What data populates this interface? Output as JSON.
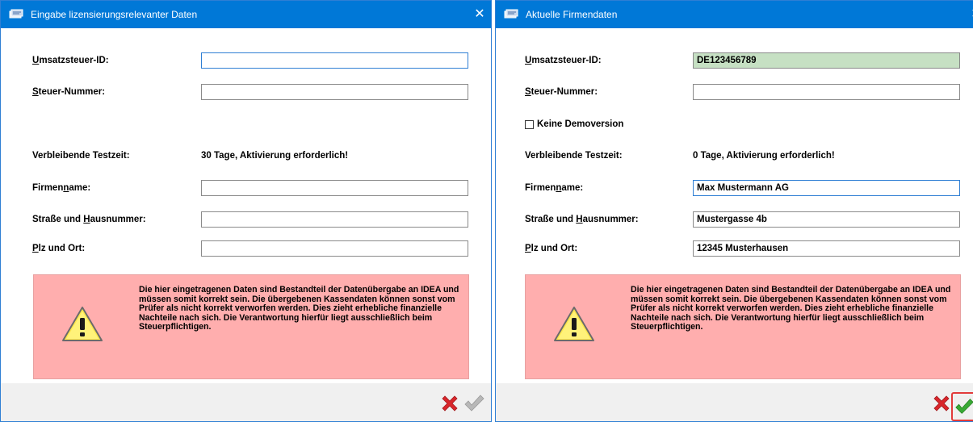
{
  "left_window": {
    "title": "Eingabe lizensierungsrelevanter Daten",
    "close_glyph": "✕",
    "fields": {
      "ust_label_u": "U",
      "ust_label_rest": "msatzsteuer-ID:",
      "ust_value": "",
      "steuer_label_u": "S",
      "steuer_label_rest": "teuer-Nummer:",
      "steuer_value": "",
      "testzeit_label": "Verbleibende Testzeit:",
      "testzeit_value": "30 Tage, Aktivierung erforderlich!",
      "firma_label_pre": "Firmen",
      "firma_label_u": "n",
      "firma_label_post": "ame:",
      "firma_value": "",
      "strasse_label_pre": "Straße und ",
      "strasse_label_u": "H",
      "strasse_label_post": "ausnummer:",
      "strasse_value": "",
      "plz_label_u": "P",
      "plz_label_rest": "lz und Ort:",
      "plz_value": ""
    },
    "warning_text": "Die hier eingetragenen Daten sind Bestandteil der Datenübergabe an IDEA und müssen somit korrekt sein. Die übergebenen Kassendaten können sonst vom Prüfer als nicht korrekt verworfen werden. Dies zieht erhebliche finanzielle Nachteile nach sich. Die Verantwortung hierfür liegt ausschließlich beim Steuerpflichtigen."
  },
  "right_window": {
    "title": "Aktuelle Firmendaten",
    "close_glyph": "✕",
    "fields": {
      "ust_label_u": "U",
      "ust_label_rest": "msatzsteuer-ID:",
      "ust_value": "DE123456789",
      "steuer_label_u": "S",
      "steuer_label_rest": "teuer-Nummer:",
      "steuer_value": "",
      "demo_label": "Keine Demoversion",
      "testzeit_label": "Verbleibende Testzeit:",
      "testzeit_value": "0 Tage, Aktivierung erforderlich!",
      "firma_label_pre": "Firmen",
      "firma_label_u": "n",
      "firma_label_post": "ame:",
      "firma_value": "Max Mustermann AG",
      "strasse_label_pre": "Straße und ",
      "strasse_label_u": "H",
      "strasse_label_post": "ausnummer:",
      "strasse_value": "Mustergasse 4b",
      "plz_label_u": "P",
      "plz_label_rest": "lz und Ort:",
      "plz_value": "12345 Musterhausen"
    },
    "warning_text": "Die hier eingetragenen Daten sind Bestandteil der Datenübergabe an IDEA und müssen somit korrekt sein. Die übergebenen Kassendaten können sonst vom Prüfer als nicht korrekt verworfen werden. Dies zieht erhebliche finanzielle Nachteile nach sich. Die Verantwortung hierfür liegt ausschließlich beim Steuerpflichtigen."
  },
  "colors": {
    "titlebar": "#0078d7",
    "warning_bg": "#ffaeae",
    "valid_field_bg": "#c6e0c3",
    "cancel_red": "#d9262b",
    "ok_green": "#39a935",
    "ok_disabled": "#b8b8b8"
  },
  "icons": [
    "app-icon",
    "close-icon",
    "warning-icon",
    "cancel-icon",
    "confirm-icon"
  ]
}
